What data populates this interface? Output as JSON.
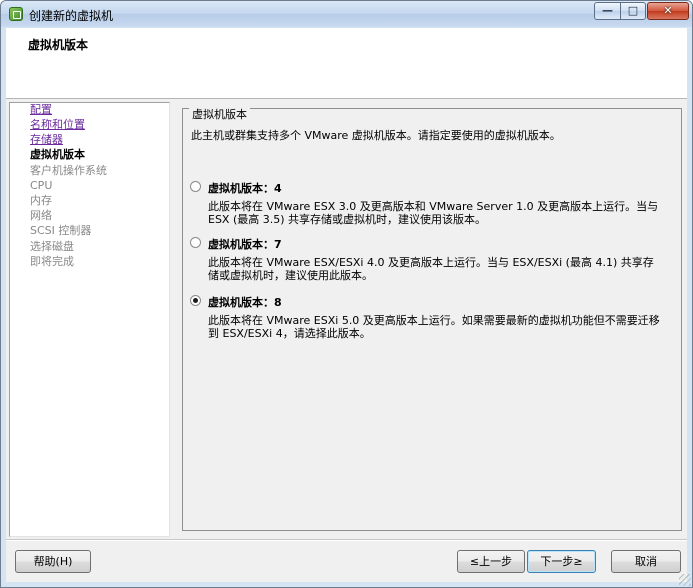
{
  "window": {
    "title": "创建新的虚拟机",
    "app_icon": "vsphere-icon",
    "controls": {
      "minimize": "minimize-icon",
      "maximize": "maximize-icon",
      "close": "close-icon"
    }
  },
  "header": {
    "title": "虚拟机版本"
  },
  "nav": {
    "items": [
      {
        "label": "配置",
        "state": "link"
      },
      {
        "label": "名称和位置",
        "state": "link"
      },
      {
        "label": "存储器",
        "state": "link"
      },
      {
        "label": "虚拟机版本",
        "state": "current"
      },
      {
        "label": "客户机操作系统",
        "state": "disabled"
      },
      {
        "label": "CPU",
        "state": "disabled"
      },
      {
        "label": "内存",
        "state": "disabled"
      },
      {
        "label": "网络",
        "state": "disabled"
      },
      {
        "label": "SCSI 控制器",
        "state": "disabled"
      },
      {
        "label": "选择磁盘",
        "state": "disabled"
      },
      {
        "label": "即将完成",
        "state": "disabled"
      }
    ]
  },
  "main": {
    "group_title": "虚拟机版本",
    "intro": "此主机或群集支持多个 VMware 虚拟机版本。请指定要使用的虚拟机版本。",
    "options": [
      {
        "label": "虚拟机版本：4",
        "checked": false,
        "description": "此版本将在 VMware ESX 3.0 及更高版本和 VMware Server 1.0 及更高版本上运行。当与 ESX (最高 3.5) 共享存储或虚拟机时，建议使用该版本。"
      },
      {
        "label": "虚拟机版本：7",
        "checked": false,
        "description": "此版本将在 VMware ESX/ESXi 4.0 及更高版本上运行。当与 ESX/ESXi (最高 4.1) 共享存储或虚拟机时，建议使用此版本。"
      },
      {
        "label": "虚拟机版本：8",
        "checked": true,
        "description": "此版本将在 VMware ESXi 5.0 及更高版本上运行。如果需要最新的虚拟机功能但不需要迁移到 ESX/ESXi 4，请选择此版本。"
      }
    ]
  },
  "footer": {
    "help_label": "帮助(H)",
    "back_label": "≤上一步",
    "next_label": "下一步≥",
    "cancel_label": "取消"
  }
}
